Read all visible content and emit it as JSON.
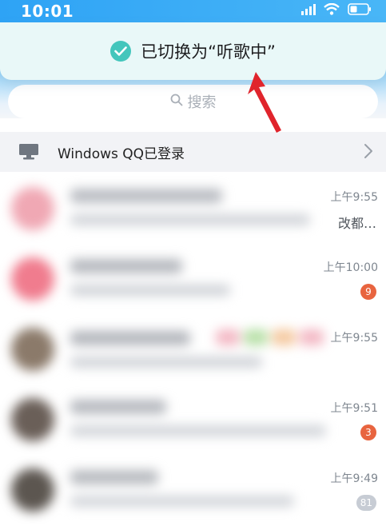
{
  "status_bar": {
    "time": "10:01",
    "icons": [
      "signal-icon",
      "wifi-icon",
      "battery-icon"
    ]
  },
  "toast": {
    "text": "已切换为“听歌中”",
    "icon": "check-circle-icon",
    "icon_color": "#43c6bc"
  },
  "search": {
    "placeholder": "搜索",
    "icon": "search-icon"
  },
  "windows_login": {
    "label": "Windows QQ已登录",
    "icon": "monitor-icon",
    "chevron": "chevron-right-icon"
  },
  "chats": [
    {
      "time": "上午9:55",
      "preview": "改都…",
      "badge": "",
      "avatar_color": "#f0a8b4"
    },
    {
      "time": "上午10:00",
      "preview": "",
      "badge": "9",
      "badge_color": "#e8643f",
      "avatar_color": "#f07c8e"
    },
    {
      "time": "上午9:55",
      "preview": "",
      "badge": "",
      "avatar_color": "#8b7a6a"
    },
    {
      "time": "上午9:51",
      "preview": "",
      "badge": "3",
      "badge_color": "#e8643f",
      "avatar_color": "#6a5f58"
    },
    {
      "time": "上午9:49",
      "preview": "",
      "badge": "81",
      "badge_color": "#c7ccd4",
      "avatar_color": "#5c5650"
    }
  ],
  "colors": {
    "header_blue": "#2ea3f5",
    "annotation_red": "#e0242c"
  }
}
